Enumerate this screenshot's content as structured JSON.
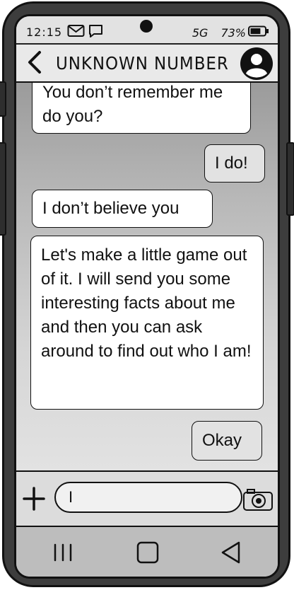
{
  "status_bar": {
    "time": "12:15",
    "icons": [
      "mail-icon",
      "chat-icon"
    ],
    "network": "5G",
    "battery": "73%",
    "battery_level": 0.73
  },
  "header": {
    "back_icon": "chevron-left-icon",
    "title": "UNKNOWN NUMBER",
    "avatar_icon": "person-icon"
  },
  "messages": [
    {
      "sender": "them",
      "text": "You don’t remember me do you?"
    },
    {
      "sender": "me",
      "text": "I do!"
    },
    {
      "sender": "them",
      "text": "I don’t believe you"
    },
    {
      "sender": "them",
      "text": "Let's make a little game out of it. I will send you some interesting facts about me and then you can ask around to find out who I am!"
    },
    {
      "sender": "me",
      "text": "Okay"
    }
  ],
  "composer": {
    "value": "I",
    "add_icon": "plus-icon",
    "camera_icon": "camera-icon"
  },
  "nav_bar": {
    "recents_icon": "recents-icon",
    "home_icon": "home-icon",
    "back_icon": "back-triangle-icon"
  },
  "colors": {
    "frame": "#3d3d3d",
    "screen_bg": "#d8d8d8",
    "incoming_bubble": "#ffffff",
    "outgoing_bubble": "#e2e2e2"
  }
}
